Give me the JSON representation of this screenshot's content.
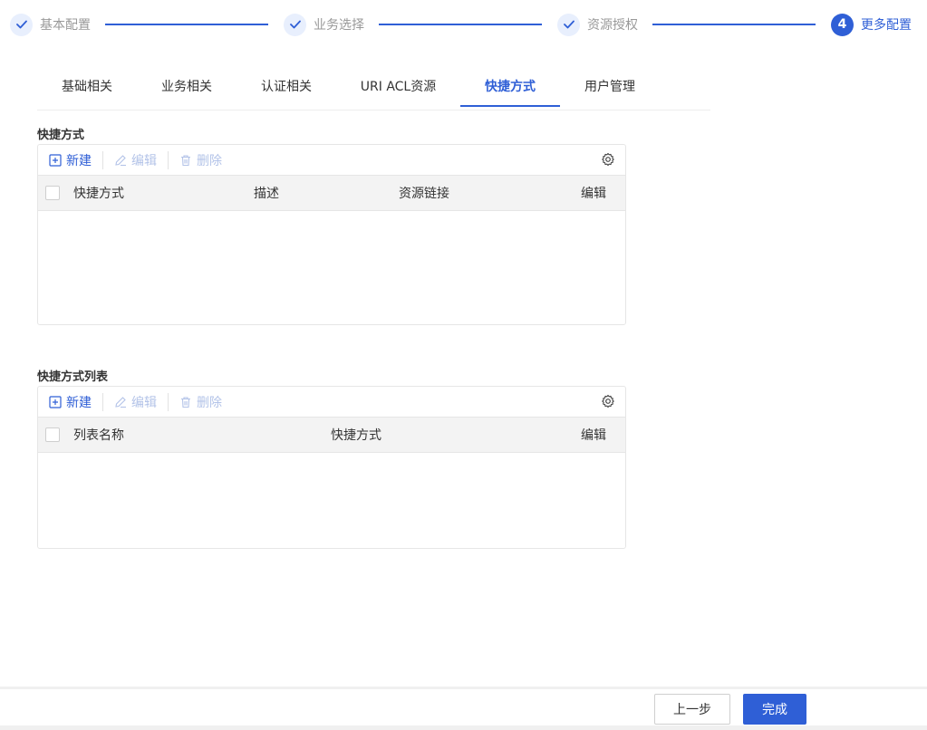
{
  "steps": [
    {
      "label": "基本配置",
      "state": "done"
    },
    {
      "label": "业务选择",
      "state": "done"
    },
    {
      "label": "资源授权",
      "state": "done"
    },
    {
      "label": "更多配置",
      "state": "active",
      "number": "4"
    }
  ],
  "tabs": [
    "基础相关",
    "业务相关",
    "认证相关",
    "URI ACL资源",
    "快捷方式",
    "用户管理"
  ],
  "active_tab": "快捷方式",
  "shortcut_section": {
    "title": "快捷方式",
    "toolbar": {
      "new": "新建",
      "edit": "编辑",
      "delete": "删除"
    },
    "columns": [
      "快捷方式",
      "描述",
      "资源链接",
      "编辑"
    ]
  },
  "shortcut_list_section": {
    "title": "快捷方式列表",
    "toolbar": {
      "new": "新建",
      "edit": "编辑",
      "delete": "删除"
    },
    "columns": [
      "列表名称",
      "快捷方式",
      "编辑"
    ]
  },
  "footer": {
    "prev": "上一步",
    "done": "完成"
  },
  "colors": {
    "accent": "#2f5fd6",
    "disabled": "#b3c3e8"
  },
  "icons": {
    "done_step": "check-icon",
    "new": "plus-square-icon",
    "edit": "pencil-icon",
    "delete": "trash-icon",
    "settings": "gear-icon"
  }
}
